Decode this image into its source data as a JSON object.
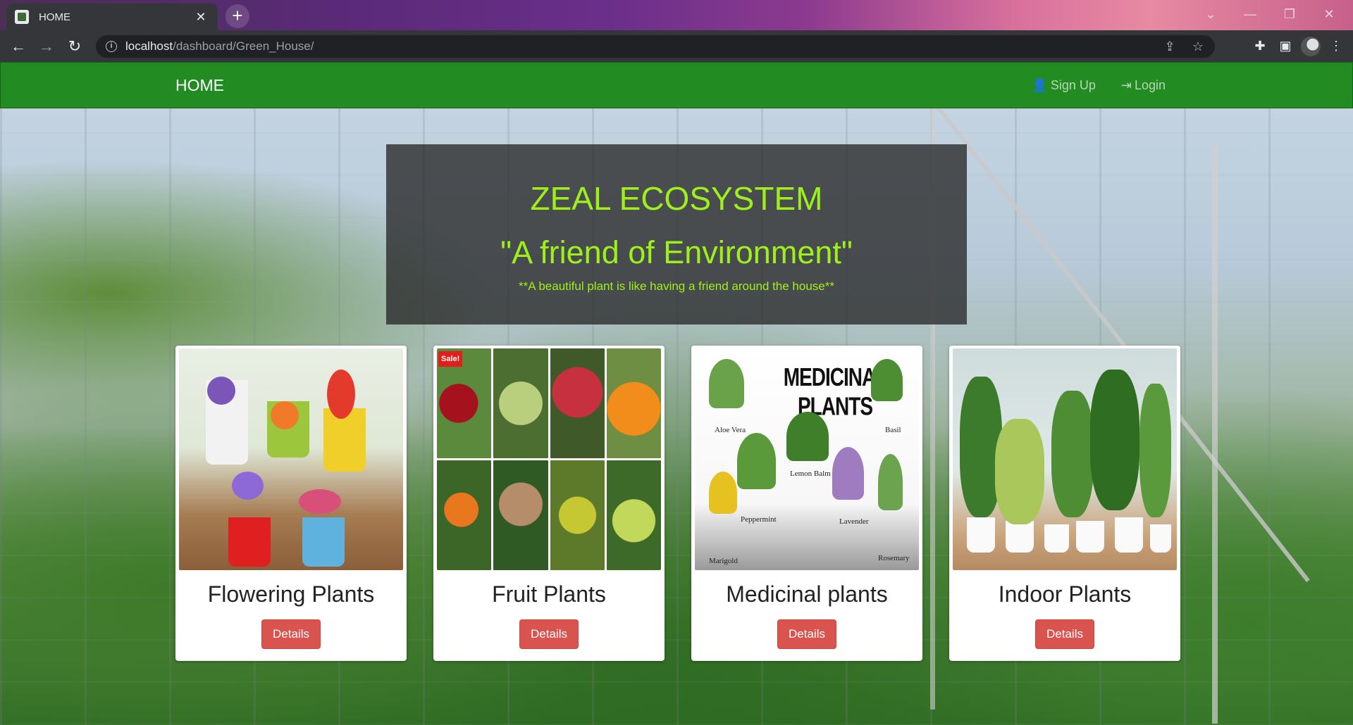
{
  "browser": {
    "tab_title": "HOME",
    "url_host": "localhost",
    "url_path": "/dashboard/Green_House/"
  },
  "navbar": {
    "brand": "HOME",
    "links": [
      {
        "label": "Sign Up",
        "icon": "user-icon"
      },
      {
        "label": "Login",
        "icon": "login-icon"
      }
    ]
  },
  "hero": {
    "title": "ZEAL ECOSYSTEM",
    "subtitle": "\"A friend of Environment\"",
    "quote": "**A beautiful plant is like having a friend around the house**"
  },
  "cards": [
    {
      "title": "Flowering Plants",
      "button": "Details"
    },
    {
      "title": "Fruit Plants",
      "button": "Details",
      "badge": "Sale!"
    },
    {
      "title": "Medicinal plants",
      "button": "Details",
      "image_text": {
        "heading": "MEDICINAL PLANTS",
        "labels": [
          "Aloe Vera",
          "Basil",
          "Lemon Balm",
          "Peppermint",
          "Lavender",
          "Marigold",
          "Rosemary"
        ]
      }
    },
    {
      "title": "Indoor Plants",
      "button": "Details"
    }
  ],
  "colors": {
    "navbar": "#228b22",
    "hero_text": "#9ef01a",
    "button": "#d9534f"
  }
}
